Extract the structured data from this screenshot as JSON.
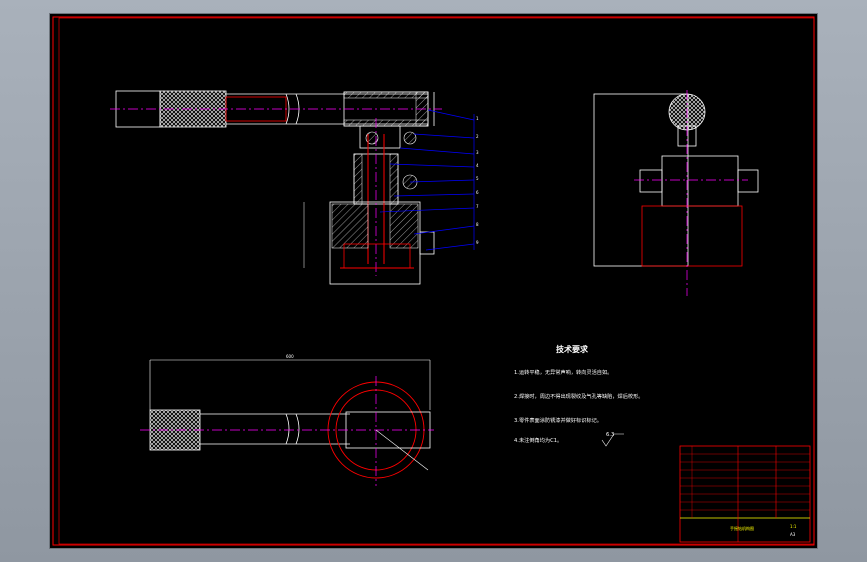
{
  "drawing": {
    "tech_title": "技术要求",
    "notes": [
      "1.运转平稳，无异常声响，转向灵活自如。",
      "2.焊接时，周边不得出现裂纹及气孔等缺陷，焊后校形。",
      "3.零件表面涂防锈漆并做好标识标记。",
      "4.未注倒角均为C1。"
    ],
    "roughness_symbol": "6.3",
    "dimension_top": "600",
    "balloons": [
      "1",
      "2",
      "3",
      "4",
      "5",
      "6",
      "7",
      "8",
      "9"
    ],
    "title_block": {
      "drawing_name": "手摇钻机构图",
      "scale": "1:1",
      "material": "A3"
    }
  },
  "colors": {
    "background": "#000000",
    "frame": "#ff0000",
    "outline": "#ffffff",
    "centerline": "#ff00ff",
    "leader": "#0000ff",
    "hatch": "#ffffff",
    "title_text": "#ffff00"
  }
}
